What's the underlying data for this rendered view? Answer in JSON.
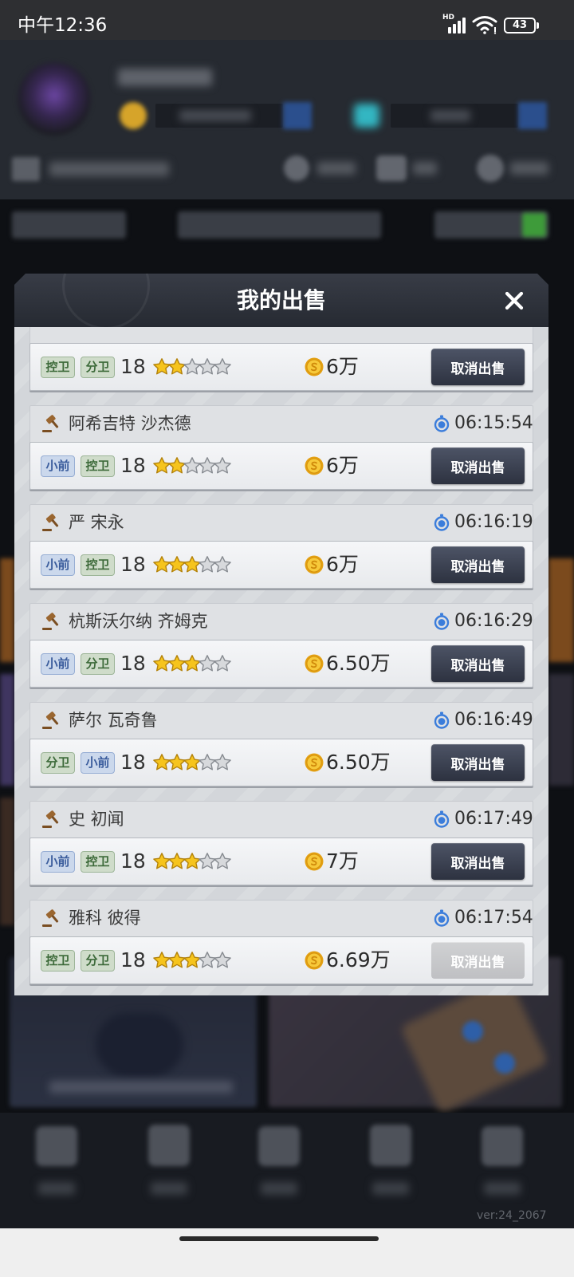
{
  "status_bar": {
    "time": "中午12:36",
    "network_badge": "HD",
    "battery_level": "43"
  },
  "modal": {
    "title": "我的出售",
    "cancel_label": "取消出售"
  },
  "icons": {
    "close": "close-icon",
    "auction": "gavel-icon",
    "timer": "stopwatch-icon",
    "currency": "coin-icon",
    "rating": "star-icon",
    "signal": "signal-icon",
    "wifi": "wifi-icon",
    "battery": "battery-icon"
  },
  "colors": {
    "button": "#3b4152",
    "button_disabled": "#c6c7ca",
    "timer_icon": "#3b7ddb",
    "gavel_icon": "#8b5a2b",
    "coin": "#f2bb1d",
    "star_filled": "#f6c41d",
    "star_filled_edge": "#b3820a",
    "star_empty": "#d7d9dc",
    "star_empty_edge": "#868a90"
  },
  "tag_colors": {
    "控卫": {
      "fg": "#3d6a3a",
      "bg": "#cfdcca",
      "border": "#9db598"
    },
    "分卫": {
      "fg": "#3d6a3a",
      "bg": "#cfdcca",
      "border": "#9db598"
    },
    "小前": {
      "fg": "#3a5c9c",
      "bg": "#cbd8ec",
      "border": "#97aed4"
    }
  },
  "listings": [
    {
      "positions": [
        "控卫",
        "分卫"
      ],
      "level": "18",
      "stars_filled": 2,
      "stars_total": 5,
      "price": "6万",
      "cancel_enabled": true
    },
    {
      "name": "阿希吉特 沙杰德",
      "timer": "06:15:54",
      "positions": [
        "小前",
        "控卫"
      ],
      "level": "18",
      "stars_filled": 2,
      "stars_total": 5,
      "price": "6万",
      "cancel_enabled": true
    },
    {
      "name": "严 宋永",
      "timer": "06:16:19",
      "positions": [
        "小前",
        "控卫"
      ],
      "level": "18",
      "stars_filled": 3,
      "stars_total": 5,
      "price": "6万",
      "cancel_enabled": true
    },
    {
      "name": "杭斯沃尔纳 齐姆克",
      "timer": "06:16:29",
      "positions": [
        "小前",
        "分卫"
      ],
      "level": "18",
      "stars_filled": 3,
      "stars_total": 5,
      "price": "6.50万",
      "cancel_enabled": true
    },
    {
      "name": "萨尔 瓦奇鲁",
      "timer": "06:16:49",
      "positions": [
        "分卫",
        "小前"
      ],
      "level": "18",
      "stars_filled": 3,
      "stars_total": 5,
      "price": "6.50万",
      "cancel_enabled": true
    },
    {
      "name": "史 初闻",
      "timer": "06:17:49",
      "positions": [
        "小前",
        "控卫"
      ],
      "level": "18",
      "stars_filled": 3,
      "stars_total": 5,
      "price": "7万",
      "cancel_enabled": true
    },
    {
      "name": "雅科 彼得",
      "timer": "06:17:54",
      "positions": [
        "控卫",
        "分卫"
      ],
      "level": "18",
      "stars_filled": 3,
      "stars_total": 5,
      "price": "6.69万",
      "cancel_enabled": false
    }
  ],
  "footer": {
    "version": "ver:24_2067"
  }
}
